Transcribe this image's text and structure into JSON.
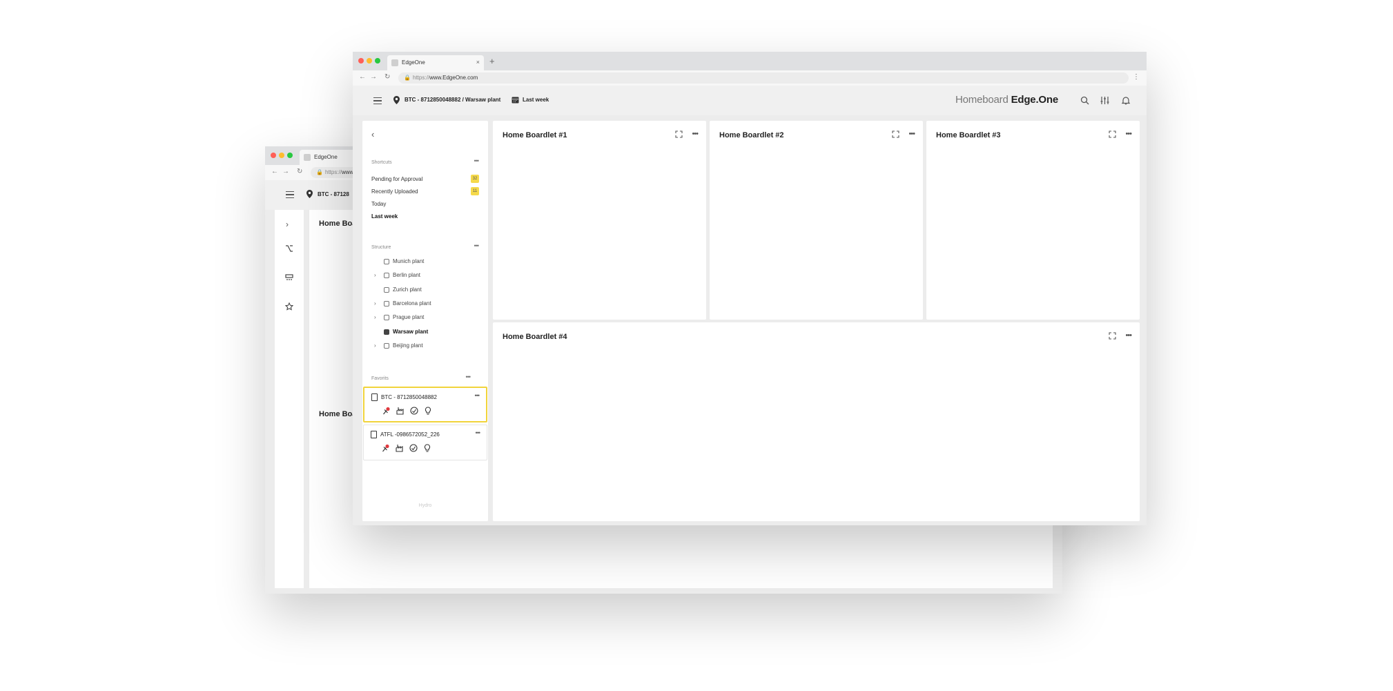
{
  "colors": {
    "accent_yellow": "#f5d94a",
    "selected_border": "#f1d43b",
    "close_red": "#ff5f57",
    "minimize_yellow": "#febc2e",
    "maximize_green": "#28c840",
    "pin_red": "#e0393e"
  },
  "back_window": {
    "tab_title": "EdgeOne",
    "url_prefix": "https://",
    "url_host": "www",
    "breadcrumb": "BTC - 87128",
    "rail_icons": [
      "chevron-right-icon",
      "branch-icon",
      "storage-icon",
      "star-icon"
    ],
    "card_titles": [
      "Home Boa",
      "Home Boa"
    ]
  },
  "front_window": {
    "tab_title": "EdgeOne",
    "tab_close": "×",
    "new_tab": "+",
    "url_prefix": "https://",
    "url_host": "www.EdgeOne.com",
    "breadcrumb": "BTC - 8712850048882 / Warsaw plant",
    "period": "Last week",
    "brand_left": "Homeboard ",
    "brand_right": "Edge.One",
    "header_icons": [
      "search-icon",
      "sliders-icon",
      "bell-icon"
    ],
    "sidebar": {
      "back": "‹",
      "shortcuts_title": "Shortcuts",
      "shortcuts": [
        {
          "label": "Pending for Approval",
          "badge": "32"
        },
        {
          "label": "Recently Uploaded",
          "badge": "11"
        },
        {
          "label": "Today",
          "badge": ""
        },
        {
          "label": "Last week",
          "badge": ""
        }
      ],
      "structure_title": "Structure",
      "structure": [
        {
          "label": "Munich plant",
          "expandable": false
        },
        {
          "label": "Berlin plant",
          "expandable": true
        },
        {
          "label": "Zurich plant",
          "expandable": false
        },
        {
          "label": "Barcelona plant",
          "expandable": true
        },
        {
          "label": "Prague plant",
          "expandable": true
        },
        {
          "label": "Warsaw plant",
          "expandable": false
        },
        {
          "label": "Beijing plant",
          "expandable": true
        }
      ],
      "favorites_title": "Favorits",
      "favorites": [
        {
          "name": "BTC - 8712850048882",
          "selected": true
        },
        {
          "name": "ATFL -0986572052_226",
          "selected": false
        }
      ],
      "fav_tool_icons": [
        "pin-icon",
        "factory-icon",
        "gauge-icon",
        "bulb-icon"
      ],
      "logo_text": "Hydro"
    },
    "cards": [
      {
        "title": "Home Boardlet #1"
      },
      {
        "title": "Home Boardlet #2"
      },
      {
        "title": "Home Boardlet #3"
      },
      {
        "title": "Home Boardlet #4"
      }
    ],
    "more_glyph": "•••"
  }
}
